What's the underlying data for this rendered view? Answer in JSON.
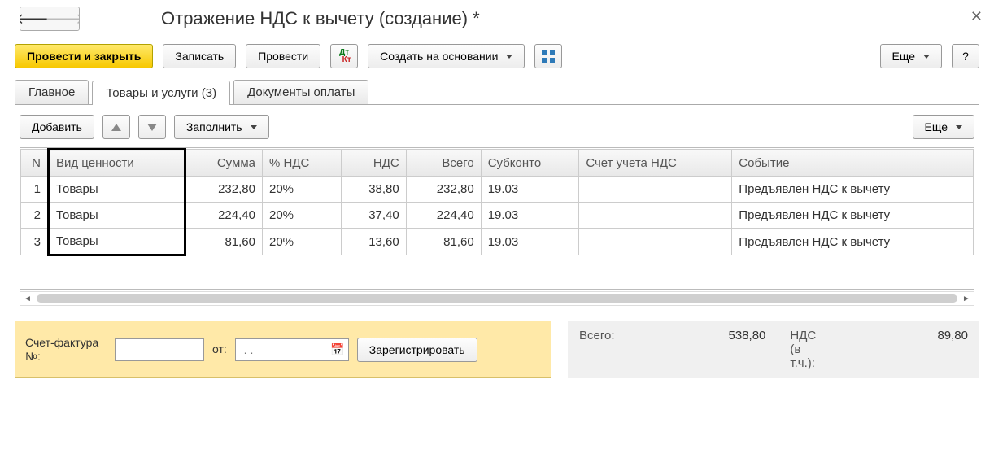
{
  "header": {
    "title": "Отражение НДС к вычету (создание) *"
  },
  "toolbar": {
    "post_close": "Провести и закрыть",
    "save": "Записать",
    "post": "Провести",
    "create_based": "Создать на основании",
    "more": "Еще",
    "help": "?"
  },
  "tabs": {
    "main": "Главное",
    "goods": "Товары и услуги (3)",
    "payments": "Документы оплаты"
  },
  "subtoolbar": {
    "add": "Добавить",
    "fill": "Заполнить",
    "more": "Еще"
  },
  "columns": {
    "n": "N",
    "type": "Вид ценности",
    "sum": "Сумма",
    "vat_pct": "% НДС",
    "vat": "НДС",
    "total": "Всего",
    "subkonto": "Субконто",
    "vat_account": "Счет учета НДС",
    "event": "Событие"
  },
  "rows": [
    {
      "n": "1",
      "type": "Товары",
      "sum": "232,80",
      "vat_pct": "20%",
      "vat": "38,80",
      "total": "232,80",
      "subkonto": "19.03",
      "vat_account": "",
      "event": "Предъявлен НДС к вычету"
    },
    {
      "n": "2",
      "type": "Товары",
      "sum": "224,40",
      "vat_pct": "20%",
      "vat": "37,40",
      "total": "224,40",
      "subkonto": "19.03",
      "vat_account": "",
      "event": "Предъявлен НДС к вычету"
    },
    {
      "n": "3",
      "type": "Товары",
      "sum": "81,60",
      "vat_pct": "20%",
      "vat": "13,60",
      "total": "81,60",
      "subkonto": "19.03",
      "vat_account": "",
      "event": "Предъявлен НДС к вычету"
    }
  ],
  "footer": {
    "invoice_label": "Счет-фактура №:",
    "from_label": "от:",
    "date_placeholder": " . . ",
    "register": "Зарегистрировать",
    "total_label": "Всего:",
    "total_value": "538,80",
    "vat_label": "НДС (в т.ч.):",
    "vat_value": "89,80"
  }
}
